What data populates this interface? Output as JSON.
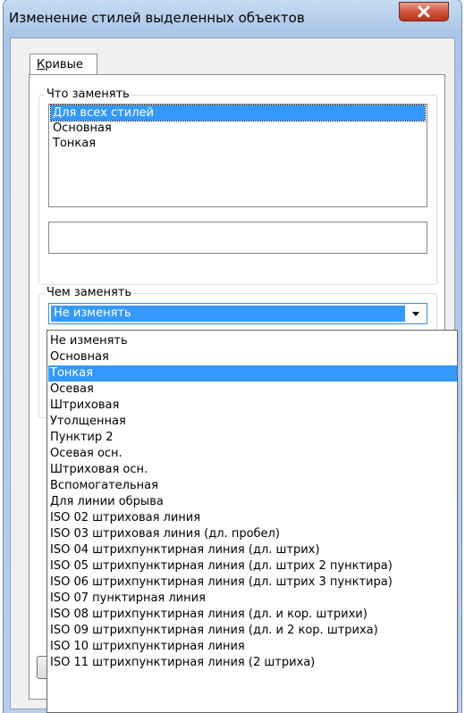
{
  "window": {
    "title": "Изменение стилей выделенных объектов",
    "close_label": "X"
  },
  "tab": {
    "label": "Кривые"
  },
  "what_group": {
    "label": "Что заменять",
    "items": [
      "Для всех стилей",
      "Основная",
      "Тонкая"
    ],
    "selected_index": 0,
    "text_value": ""
  },
  "with_group": {
    "label": "Чем заменять",
    "selected_value": "Не изменять"
  },
  "dropdown": {
    "selected_index": 2,
    "items": [
      "Не изменять",
      "Основная",
      "Тонкая",
      "Осевая",
      "Штриховая",
      "Утолщенная",
      "Пунктир 2",
      "Осевая осн.",
      "Штриховая осн.",
      "Вспомогательная",
      "Для линии обрыва",
      "ISO 02 штриховая линия",
      "ISO 03 штриховая линия (дл. пробел)",
      "ISO 04 штрихпунктирная линия (дл. штрих)",
      "ISO 05 штрихпунктирная линия (дл. штрих 2 пунктира)",
      "ISO 06 штрихпунктирная линия (дл. штрих 3 пунктира)",
      "ISO 07 пунктирная линия",
      "ISO 08 штрихпунктирная линия (дл. и кор. штрихи)",
      "ISO 09 штрихпунктирная линия (дл. и 2 кор. штриха)",
      "ISO 10 штрихпунктирная линия",
      "ISO 11 штрихпунктирная линия (2 штриха)"
    ]
  }
}
